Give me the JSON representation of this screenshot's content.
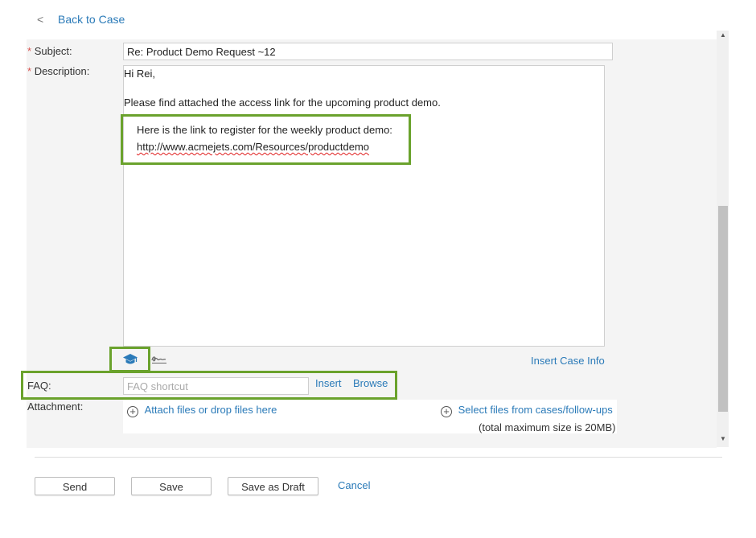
{
  "nav": {
    "back_chevron": "<",
    "back_label": "Back to Case"
  },
  "form": {
    "required_mark": "*",
    "subject_label": "Subject:",
    "subject_value": "Re: Product Demo Request ~12",
    "description_label": "Description:",
    "body": {
      "greeting": "Hi Rei,",
      "line1": "Please find attached the access link for the upcoming product demo.",
      "highlight_line1": "Here is the link to register for the weekly product demo:",
      "highlight_line2": "http://www.acmejets.com/Resources/productdemo"
    },
    "insert_case_info": "Insert Case Info",
    "faq_label": "FAQ:",
    "faq_placeholder": "FAQ shortcut",
    "faq_insert": "Insert",
    "faq_browse": "Browse",
    "attachment_label": "Attachment:",
    "attach_files": "Attach files or drop files here",
    "select_files": "Select files from cases/follow-ups",
    "size_note": "(total maximum size is 20MB)"
  },
  "toolbar_icons": [
    "graduation-cap-icon",
    "signature-icon"
  ],
  "buttons": {
    "send": "Send",
    "save": "Save",
    "save_draft": "Save as Draft",
    "cancel": "Cancel"
  },
  "colors": {
    "accent": "#2a7ab8",
    "highlight": "#6aa22c",
    "required": "#d9534f",
    "panel": "#f4f4f4"
  }
}
